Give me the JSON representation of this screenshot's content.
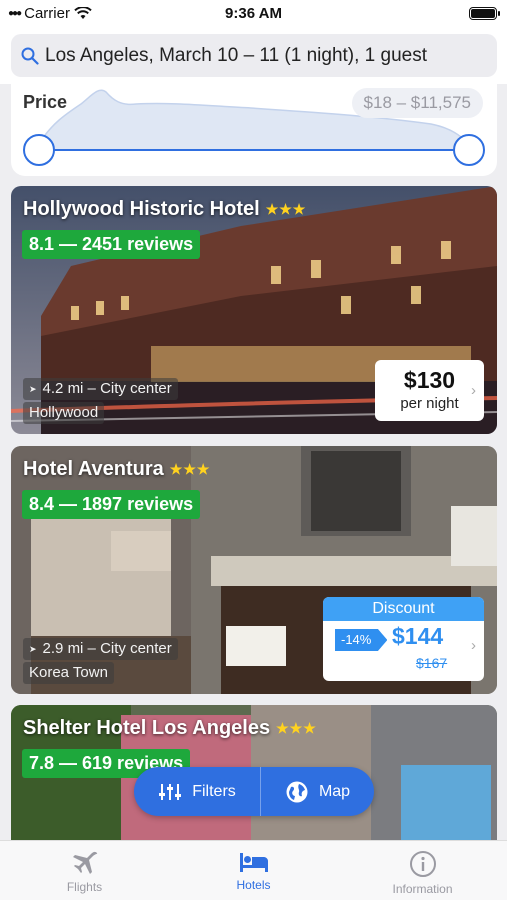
{
  "status_bar": {
    "carrier": "Carrier",
    "time": "9:36 AM"
  },
  "search": {
    "query": "Los Angeles, March 10 – 11 (1 night), 1 guest"
  },
  "price_filter": {
    "label": "Price",
    "range": "$18 – $11,575",
    "min_fraction": 0,
    "max_fraction": 1
  },
  "hotels": [
    {
      "name": "Hollywood Historic Hotel",
      "stars": "★★★",
      "rating": "8.1 — 2451 reviews",
      "distance": "4.2 mi – City center",
      "area": "Hollywood",
      "price": "$130",
      "per": "per night"
    },
    {
      "name": "Hotel Aventura",
      "stars": "★★★",
      "rating": "8.4 — 1897 reviews",
      "distance": "2.9 mi – City center",
      "area": "Korea Town",
      "discount_label": "Discount",
      "discount_pct": "-14%",
      "price": "$144",
      "old_price": "$167"
    },
    {
      "name": "Shelter Hotel Los Angeles",
      "stars": "★★★",
      "rating": "7.8 — 619 reviews"
    }
  ],
  "actions": {
    "filters": "Filters",
    "map": "Map"
  },
  "tabs": [
    {
      "label": "Flights",
      "icon": "airplane-icon"
    },
    {
      "label": "Hotels",
      "icon": "bed-icon"
    },
    {
      "label": "Information",
      "icon": "info-icon"
    }
  ],
  "colors": {
    "accent": "#2f6fe0",
    "rating_green": "#1ea83c",
    "discount_blue": "#3fa1f5",
    "star_yellow": "#ffd21f"
  }
}
